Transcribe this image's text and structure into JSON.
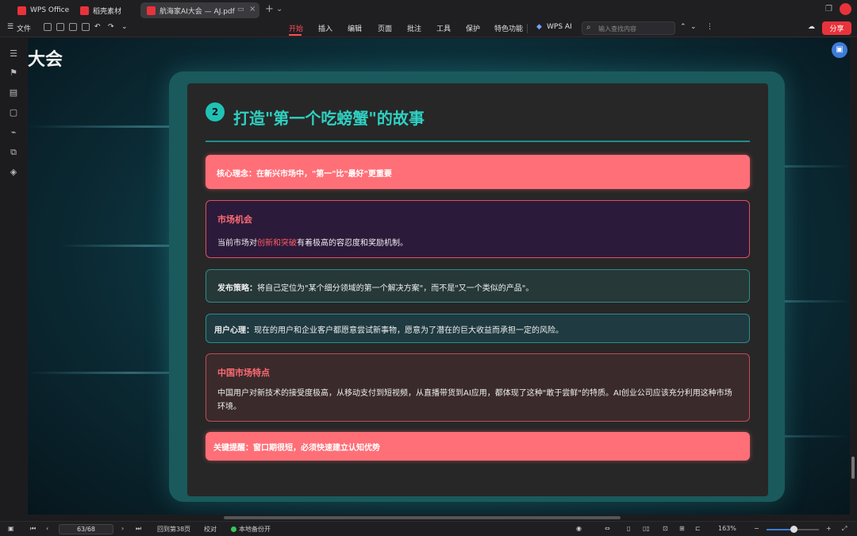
{
  "tabs": [
    {
      "label": "WPS Office",
      "icon": "wps-logo-icon"
    },
    {
      "label": "稻壳素材",
      "icon": "docer-icon"
    },
    {
      "label": "航海家AI大会 — AJ.pdf",
      "icon": "pdf-icon"
    }
  ],
  "toolbar": {
    "file_label": "文件",
    "menu": [
      "开始",
      "插入",
      "编辑",
      "页面",
      "批注",
      "工具",
      "保护",
      "特色功能"
    ],
    "active_menu": "开始",
    "wps_ai_label": "WPS AI",
    "search_placeholder": "输入查找内容",
    "share_label": "分享"
  },
  "canvas": {
    "partial_title": "大会"
  },
  "slide": {
    "number": "2",
    "title": "打造\"第一个吃螃蟹\"的故事",
    "core_concept": "核心理念：在新兴市场中，\"第一\"比\"最好\"更重要",
    "market_opportunity": {
      "title": "市场机会",
      "text_before": "当前市场对",
      "highlight": "创新和突破",
      "text_after": "有着极高的容忍度和奖励机制。"
    },
    "release_strategy": {
      "label": "发布策略：",
      "text": "将自己定位为\"某个细分领域的第一个解决方案\"，而不是\"又一个类似的产品\"。"
    },
    "user_psychology": {
      "label": "用户心理：",
      "text": "现在的用户和企业客户都愿意尝试新事物，愿意为了潜在的巨大收益而承担一定的风险。"
    },
    "china_market": {
      "title": "中国市场特点",
      "line1": "中国用户对新技术的接受度极高，从移动支付到短视频，从直播带货到AI应用，都体现了这种\"敢于尝鲜\"的特质。AI创业公司应该充分利用这种市场",
      "line2": "环境。"
    },
    "key_reminder": "关键提醒：窗口期很短，必须快速建立认知优势"
  },
  "status": {
    "page_field": "63/68",
    "back_label": "回到第38页",
    "proofread_label": "校对",
    "backup_label": "本地备份开",
    "zoom": "163%",
    "zoom_fraction": 0.45
  },
  "colors": {
    "accent_red": "#ff4d57",
    "teal_title": "#2fd0c2",
    "share_bg": "#e8333b"
  }
}
